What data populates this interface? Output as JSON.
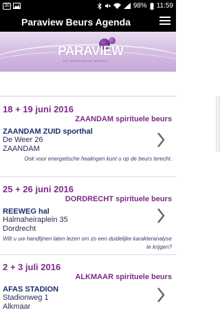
{
  "status_bar": {
    "notification_text": "30",
    "battery_percent": "98%",
    "time": "11:59"
  },
  "app_bar": {
    "title": "Paraview Beurs Agenda",
    "menu_icon": "menu-icon"
  },
  "banner": {
    "logo_text": "PARAVIEW",
    "logo_subtext": "DE SPIRITUELE BEURS"
  },
  "events": [
    {
      "date": "18 + 19 juni 2016",
      "city": "ZAANDAM spirituele beurs",
      "venue": "ZAANDAM ZUID sporthal",
      "address_line1": "De Weer 26",
      "address_line2": "ZAANDAM",
      "note": "Ook voor energetische healingen kunt u op de beurs terecht."
    },
    {
      "date": "25 + 26 juni 2016",
      "city": "DORDRECHT spirituele beurs",
      "venue": "REEWEG hal",
      "address_line1": "Halmaheiraplein 35",
      "address_line2": "Dordrecht",
      "note": "Wilt u uw handlijnen laten lezen om zo een duidelijke karakteranalyse te krijgen?"
    },
    {
      "date": "2 + 3 juli 2016",
      "city": "ALKMAAR spirituele beurs",
      "venue": "AFAS STADION",
      "address_line1": "Stadionweg 1",
      "address_line2": "Alkmaar",
      "note": ""
    }
  ],
  "colors": {
    "accent_purple": "#7b2b86",
    "venue_blue": "#1a2e6c",
    "app_bar_bg": "#000000"
  }
}
